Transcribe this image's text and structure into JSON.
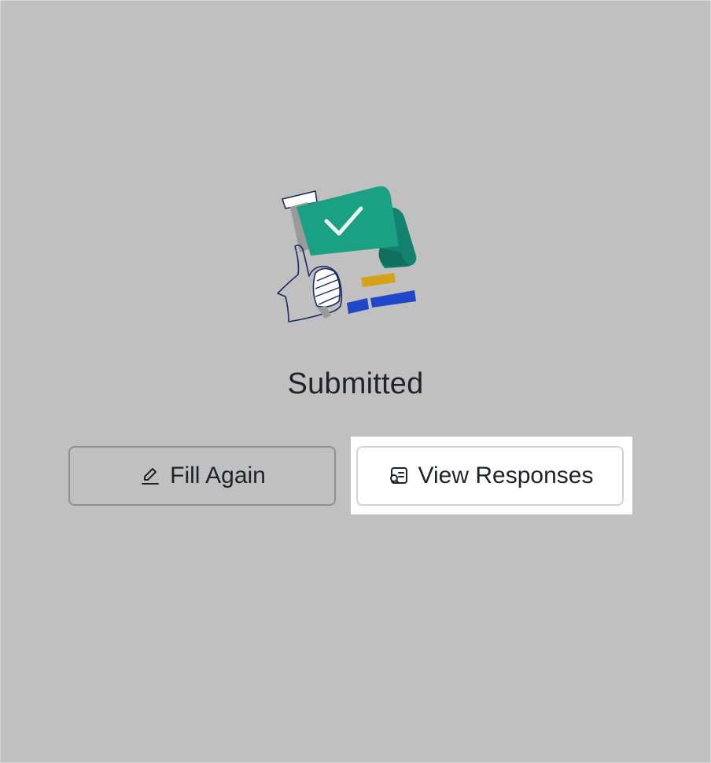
{
  "status": {
    "title": "Submitted"
  },
  "actions": {
    "fill_again_label": "Fill Again",
    "view_responses_label": "View Responses"
  },
  "icons": {
    "fill_again": "pencil-edit-icon",
    "view_responses": "search-document-icon",
    "illustration": "submitted-checkmark-illustration"
  },
  "colors": {
    "overlay_background": "#c0c0c0",
    "accent_green": "#1aa083",
    "text": "#1f2329",
    "highlight": "#ffffff"
  }
}
